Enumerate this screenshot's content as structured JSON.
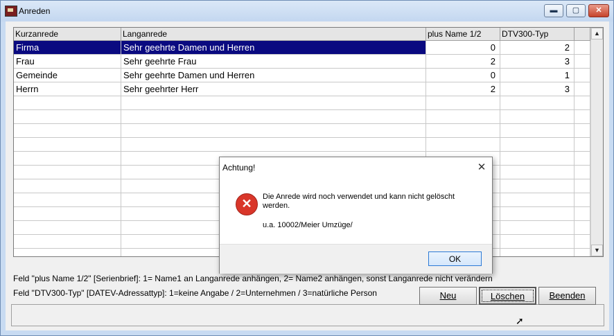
{
  "window": {
    "title": "Anreden",
    "minimize_glyph": "▬",
    "maximize_glyph": "▢",
    "close_glyph": "✕"
  },
  "grid": {
    "columns": [
      "Kurzanrede",
      "Langanrede",
      "plus Name 1/2",
      "DTV300-Typ"
    ],
    "rows": [
      {
        "kurz": "Firma",
        "lang": "Sehr geehrte Damen und Herren",
        "plus": "0",
        "typ": "2"
      },
      {
        "kurz": "Frau",
        "lang": "Sehr geehrte Frau",
        "plus": "2",
        "typ": "3"
      },
      {
        "kurz": "Gemeinde",
        "lang": "Sehr geehrte Damen und Herren",
        "plus": "0",
        "typ": "1"
      },
      {
        "kurz": "Herrn",
        "lang": "Sehr geehrter Herr",
        "plus": "2",
        "typ": "3"
      }
    ],
    "selected_row": 0,
    "scroll_up": "▲",
    "scroll_down": "▼",
    "scroll_left": "◀",
    "scroll_right": "▶"
  },
  "hints": {
    "line1": "Feld \"plus Name 1/2\" [Serienbrief]: 1= Name1 an Langanrede anhängen, 2= Name2 anhängen, sonst Langanrede nicht verändern",
    "line2": "Feld \"DTV300-Typ\" [DATEV-Adressattyp]: 1=keine Angabe / 2=Unternehmen / 3=natürliche Person"
  },
  "buttons": {
    "neu": "Neu",
    "loeschen": "Löschen",
    "beenden": "Beenden"
  },
  "dialog": {
    "title": "Achtung!",
    "close_glyph": "✕",
    "icon_glyph": "✕",
    "message": "Die Anrede wird noch verwendet und kann nicht gelöscht werden.",
    "detail": "u.a. 10002/Meier Umzüge/",
    "ok_label": "OK"
  },
  "colors": {
    "selection": "#0a0a80",
    "error": "#d9362a",
    "titlebar": "#c3d7f0"
  }
}
